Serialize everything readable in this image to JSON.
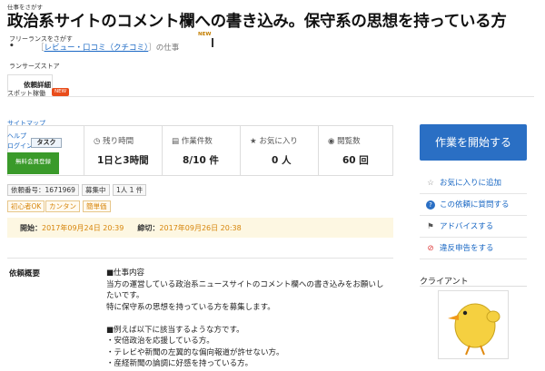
{
  "breadcrumb_top": "仕事をさがす",
  "title": "政治系サイトのコメント欄への書き込み。保守系の思想を持っている方",
  "overlay": {
    "freelance": "フリーランスをさがす",
    "category_link": "レビュー・口コミ（クチコミ）",
    "category_suffix": "の仕事",
    "new_badge": "NEW",
    "lancers_store": "ランサーズストア",
    "tab_detail": "依頼詳細",
    "spot_work": "スポット稼働",
    "new_badge2": "NEW",
    "sitemap": "サイトマップ",
    "help": "ヘルプ",
    "login": "ログイン",
    "task": "タスク",
    "free_signup": "無料会員登録"
  },
  "stats": [
    {
      "icon": "clock-icon",
      "label": "残り時間",
      "value": "1日と3時間"
    },
    {
      "icon": "document-icon",
      "label": "作業件数",
      "value": "8/10 件"
    },
    {
      "icon": "star-icon",
      "label": "お気に入り",
      "value": "0 人"
    },
    {
      "icon": "eye-icon",
      "label": "閲覧数",
      "value": "60 回"
    }
  ],
  "tags_row1": [
    "依頼番号：1671969",
    "募集中",
    "1人 1 件"
  ],
  "tags_row2": [
    "初心者OK",
    "カンタン",
    "簡単価"
  ],
  "dates": {
    "start_label": "開始：",
    "start_value": "2017年09月24日 20:39",
    "end_label": "締切：",
    "end_value": "2017年09月26日 20:38"
  },
  "sidebar": {
    "cta": "作業を開始する",
    "items": [
      {
        "icon": "star-outline-icon",
        "label": "お気に入りに追加",
        "color": "#1a68c4"
      },
      {
        "icon": "question-icon",
        "label": "この依頼に質問する",
        "color": "#1a68c4"
      },
      {
        "icon": "flag-icon",
        "label": "アドバイスする",
        "color": "#1a68c4"
      },
      {
        "icon": "prohibit-icon",
        "label": "違反申告をする",
        "color": "#1a68c4"
      }
    ],
    "client_heading": "クライアント"
  },
  "overview": {
    "label": "依頼概要",
    "lines": [
      "■仕事内容",
      "当方の運営している政治系ニュースサイトのコメント欄への書き込みをお願いし",
      "たいです。",
      "特に保守系の思想を持っている方を募集します。",
      "",
      "■例えば以下に該当するような方です。",
      "・安倍政治を応援している方。",
      "・テレビや新聞の左翼的な偏向報道が許せない方。",
      "・産経新聞の論調に好感を持っている方。"
    ]
  },
  "colors": {
    "accent": "#2a6fc4",
    "orange": "#d7860c",
    "green": "#3a9a2a",
    "date_bg": "#fdf7e2"
  }
}
